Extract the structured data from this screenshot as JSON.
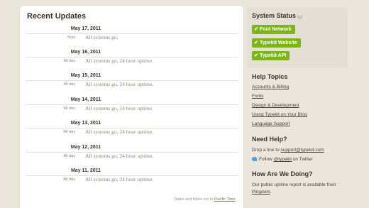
{
  "updates": {
    "title": "Recent Updates",
    "days": [
      {
        "date": "May 17, 2011",
        "when": "Now",
        "message": "All systems go."
      },
      {
        "date": "May 16, 2011",
        "when": "All day",
        "message": "All systems go, 24 hour uptime."
      },
      {
        "date": "May 15, 2011",
        "when": "All day",
        "message": "All systems go, 24 hour uptime."
      },
      {
        "date": "May 14, 2011",
        "when": "All day",
        "message": "All systems go, 24 hour uptime."
      },
      {
        "date": "May 13, 2011",
        "when": "All day",
        "message": "All systems go, 24 hour uptime."
      },
      {
        "date": "May 12, 2011",
        "when": "All day",
        "message": "All systems go, 24 hour uptime."
      },
      {
        "date": "May 11, 2011",
        "when": "All day",
        "message": "All systems go, 24 hour uptime."
      }
    ],
    "footer_prefix": "Dates and times are in",
    "footer_link": "Pacific Time",
    "footer_suffix": "."
  },
  "status": {
    "title": "System Status",
    "services": [
      "Font Network",
      "Typekit Website",
      "Typekit API"
    ],
    "status_color": "#7cb518"
  },
  "help_topics": {
    "title": "Help Topics",
    "links": [
      "Accounts & Billing",
      "Fonts",
      "Design & Development",
      "Using Typekit on Your Blog",
      "Language Support"
    ]
  },
  "need_help": {
    "title": "Need Help?",
    "drop_prefix": "Drop a line to",
    "email": "support@typekit.com",
    "follow_prefix": "Follow",
    "twitter_handle": "@typekit",
    "follow_suffix": "on Twitter"
  },
  "how_doing": {
    "title": "How Are We Doing?",
    "text": "Our public uptime report is available from",
    "link": "Pingdom",
    "suffix": "."
  }
}
